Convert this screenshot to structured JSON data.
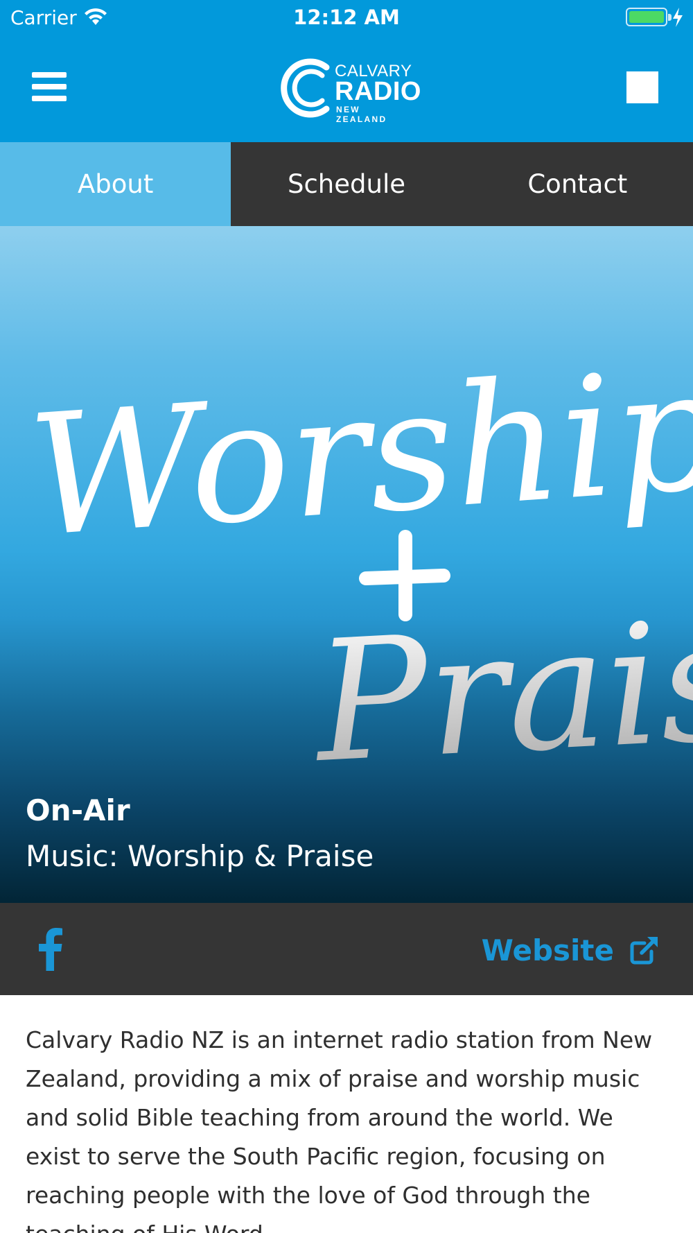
{
  "status_bar": {
    "carrier": "Carrier",
    "time": "12:12 AM",
    "icons": [
      "wifi-icon",
      "battery-icon",
      "charging-bolt-icon"
    ]
  },
  "header": {
    "logo": {
      "line1": "CALVARY",
      "line2": "RADIO",
      "line3": "NEW ZEALAND"
    },
    "left_button_icon": "menu-icon",
    "right_button_icon": "stop-icon"
  },
  "tabs": [
    {
      "label": "About",
      "active": true
    },
    {
      "label": "Schedule",
      "active": false
    },
    {
      "label": "Contact",
      "active": false
    }
  ],
  "hero": {
    "artwork_text": "Worship + Praise",
    "on_air_label": "On-Air",
    "current_show": "Music: Worship & Praise"
  },
  "social": {
    "facebook_icon": "facebook-icon",
    "website_label": "Website",
    "website_icon": "external-link-icon"
  },
  "description": "Calvary Radio NZ is an internet radio station from New Zealand, providing a mix of praise and worship music and solid Bible teaching from around the world.  We exist to serve the South Pacific region, focusing on reaching people with the love of God through the teaching of His Word.",
  "colors": {
    "header_blue": "#0299db",
    "tab_active": "#57bbe8",
    "dark_bar": "#353535",
    "link_blue": "#1a96d6"
  }
}
